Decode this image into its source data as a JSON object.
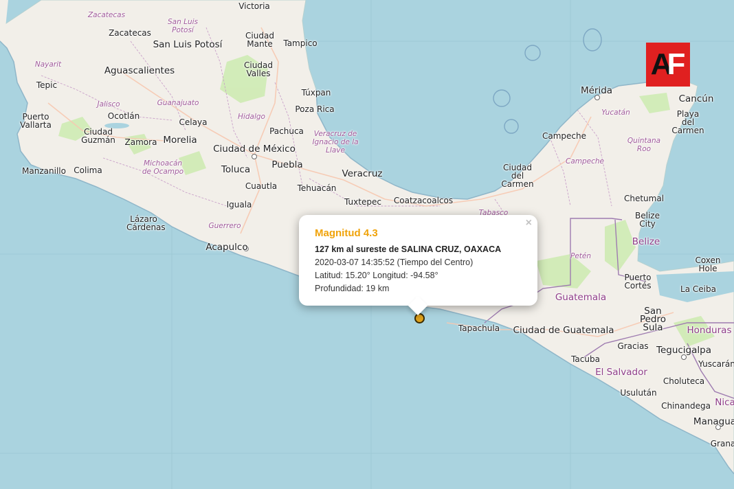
{
  "logo": {
    "letter_a": "A",
    "letter_f": "F"
  },
  "popup": {
    "magnitude": "Magnitud 4.3",
    "location": "127 km al sureste de SALINA CRUZ, OAXACA",
    "datetime": "2020-03-07  14:35:52 (Tiempo del Centro)",
    "coords": "Latitud: 15.20°  Longitud: -94.58°",
    "depth": "Profundidad: 19 km",
    "close_icon": "×"
  },
  "labels": {
    "victoria": "Victoria",
    "zacatecas_state": "Zacatecas",
    "zacatecas": "Zacatecas",
    "slp_state": "San Luis Potosí",
    "slp": "San Luis Potosí",
    "ciudad_mante": "Ciudad Mante",
    "tampico": "Tampico",
    "nayarit": "Nayarit",
    "aguascalientes": "Aguascalientes",
    "ciudad_valles": "Ciudad Valles",
    "tepic": "Tepic",
    "tuxpan": "Túxpan",
    "jalisco": "Jalisco",
    "guanajuato": "Guanajuato",
    "poza_rica": "Poza Rica",
    "puerto_vallarta": "Puerto Vallarta",
    "ocotlan": "Ocotlán",
    "celaya": "Celaya",
    "hidalgo": "Hidalgo",
    "pachuca": "Pachuca",
    "veracruz_state": "Veracruz de Ignacio de la Llave",
    "ciudad_guzman": "Ciudad Guzmán",
    "zamora": "Zamora",
    "morelia": "Morelia",
    "cdmx": "Ciudad de México",
    "manzanillo": "Manzanillo",
    "colima": "Colima",
    "michoacan": "Michoacán de Ocampo",
    "toluca": "Toluca",
    "puebla": "Puebla",
    "veracruz": "Veracruz",
    "cuautla": "Cuautla",
    "tehuacan": "Tehuacán",
    "iguala": "Iguala",
    "tuxtepec": "Tuxtepec",
    "coatzacoalcos": "Coatzacoalcos",
    "lazaro": "Lázaro Cárdenas",
    "guerrero": "Guerrero",
    "acapulco": "Acapulco",
    "tabasco": "Tabasco",
    "merida": "Mérida",
    "cancun": "Cancún",
    "yucatan": "Yucatán",
    "playa": "Playa del Carmen",
    "campeche_city": "Campeche",
    "quintana_roo": "Quintana Roo",
    "campeche_state": "Campeche",
    "ciudad_carmen": "Ciudad del Carmen",
    "chetumal": "Chetumal",
    "belize_city": "Belize City",
    "belize": "Belize",
    "peten": "Petén",
    "coxen_hole": "Coxen Hole",
    "puerto_cortes": "Puerto Cortés",
    "la_ceiba": "La Ceiba",
    "guatemala": "Guatemala",
    "san_pedro_sula": "San Pedro Sula",
    "honduras": "Honduras",
    "tapachula": "Tapachula",
    "ciudad_guatemala": "Ciudad de Guatemala",
    "gracias": "Gracias",
    "tegucigalpa": "Tegucigalpa",
    "tacuba": "Tacuba",
    "yuscaran": "Yuscarán",
    "el_salvador": "El Salvador",
    "choluteca": "Choluteca",
    "usulutan": "Usulután",
    "nica": "Nica",
    "chinandega": "Chinandega",
    "managua": "Managua",
    "granada": "Grana"
  },
  "colors": {
    "sea": "#aad3df",
    "land": "#f2efe9",
    "magnitude": "#f0a30a",
    "marker": "#e0a21c",
    "logo_bg": "#e02020"
  }
}
